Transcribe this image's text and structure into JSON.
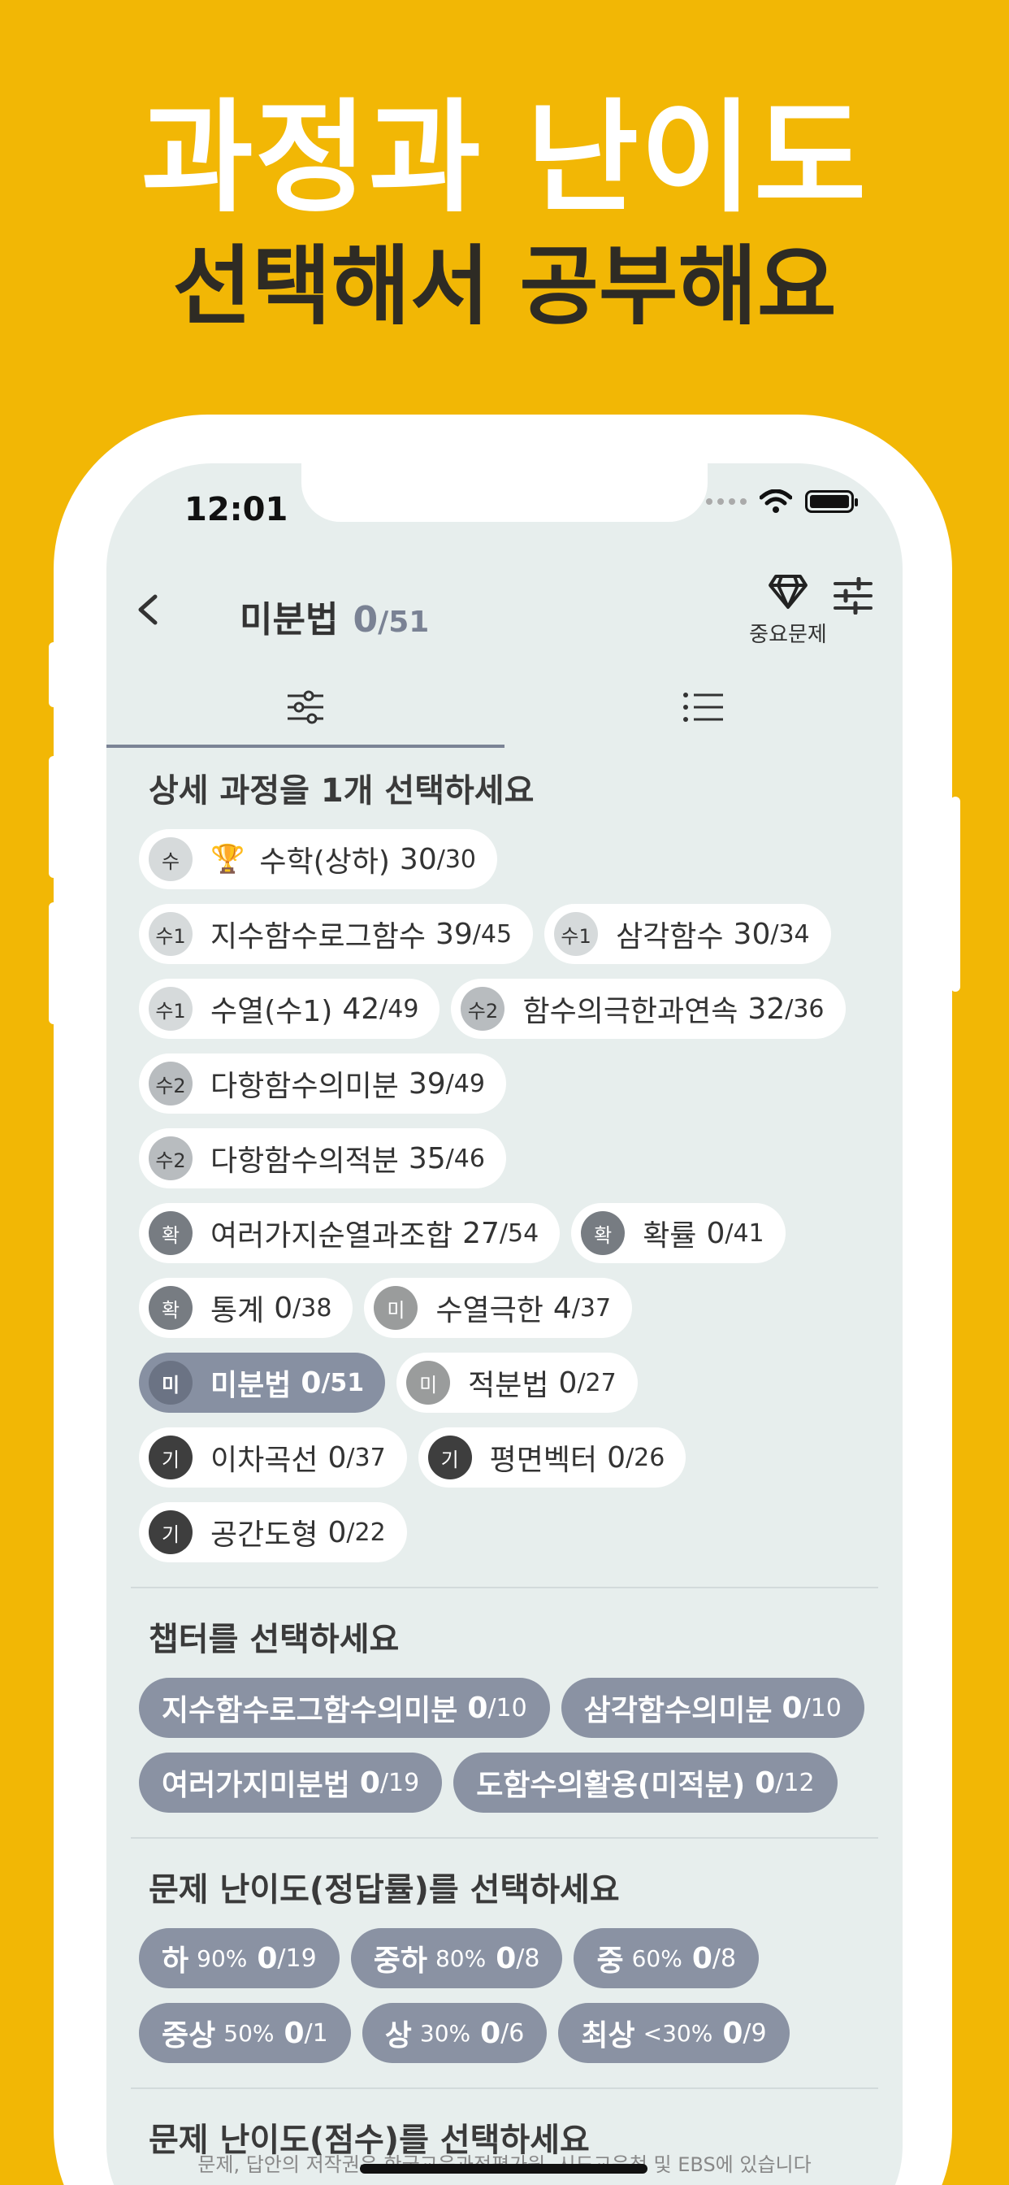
{
  "hero": {
    "title": "과정과 난이도",
    "subtitle": "선택해서 공부해요"
  },
  "status": {
    "time": "12:01"
  },
  "nav": {
    "title": "미분법",
    "count": "0",
    "total": "/51",
    "important_label": "중요문제"
  },
  "section1": {
    "title": "상세 과정을 1개 선택하세요",
    "chips": [
      {
        "badge": "수",
        "trophy": "🏆",
        "label": "수학(상하)",
        "num": "30",
        "den": "/30",
        "tone": "light"
      },
      {
        "badge": "수1",
        "label": "지수함수로그함수",
        "num": "39",
        "den": "/45",
        "tone": "light"
      },
      {
        "badge": "수1",
        "label": "삼각함수",
        "num": "30",
        "den": "/34",
        "tone": "light"
      },
      {
        "badge": "수1",
        "label": "수열(수1)",
        "num": "42",
        "den": "/49",
        "tone": "light"
      },
      {
        "badge": "수2",
        "label": "함수의극한과연속",
        "num": "32",
        "den": "/36",
        "tone": "mid"
      },
      {
        "badge": "수2",
        "label": "다항함수의미분",
        "num": "39",
        "den": "/49",
        "tone": "mid"
      },
      {
        "badge": "수2",
        "label": "다항함수의적분",
        "num": "35",
        "den": "/46",
        "tone": "mid"
      },
      {
        "badge": "확",
        "label": "여러가지순열과조합",
        "num": "27",
        "den": "/54",
        "tone": "dark"
      },
      {
        "badge": "확",
        "label": "확률",
        "num": "0",
        "den": "/41",
        "tone": "dark"
      },
      {
        "badge": "확",
        "label": "통계",
        "num": "0",
        "den": "/38",
        "tone": "dark"
      },
      {
        "badge": "미",
        "label": "수열극한",
        "num": "4",
        "den": "/37",
        "tone": "mi"
      },
      {
        "badge": "미",
        "label": "미분법",
        "num": "0",
        "den": "/51",
        "tone": "sel",
        "selected": true
      },
      {
        "badge": "미",
        "label": "적분법",
        "num": "0",
        "den": "/27",
        "tone": "mi"
      },
      {
        "badge": "기",
        "label": "이차곡선",
        "num": "0",
        "den": "/37",
        "tone": "gi"
      },
      {
        "badge": "기",
        "label": "평면벡터",
        "num": "0",
        "den": "/26",
        "tone": "gi"
      },
      {
        "badge": "기",
        "label": "공간도형",
        "num": "0",
        "den": "/22",
        "tone": "gi"
      }
    ]
  },
  "section2": {
    "title": "챕터를 선택하세요",
    "chips": [
      {
        "label": "지수함수로그함수의미분",
        "num": "0",
        "den": "/10"
      },
      {
        "label": "삼각함수의미분",
        "num": "0",
        "den": "/10"
      },
      {
        "label": "여러가지미분법",
        "num": "0",
        "den": "/19"
      },
      {
        "label": "도함수의활용(미적분)",
        "num": "0",
        "den": "/12"
      }
    ]
  },
  "section3": {
    "title": "문제 난이도(정답률)를 선택하세요",
    "chips": [
      {
        "label": "하",
        "pct": "90%",
        "num": "0",
        "den": "/19"
      },
      {
        "label": "중하",
        "pct": "80%",
        "num": "0",
        "den": "/8"
      },
      {
        "label": "중",
        "pct": "60%",
        "num": "0",
        "den": "/8"
      },
      {
        "label": "중상",
        "pct": "50%",
        "num": "0",
        "den": "/1"
      },
      {
        "label": "상",
        "pct": "30%",
        "num": "0",
        "den": "/6"
      },
      {
        "label": "최상",
        "pct": "<30%",
        "num": "0",
        "den": "/9"
      }
    ]
  },
  "section4": {
    "title": "문제 난이도(점수)를 선택하세요"
  },
  "footer": {
    "copyright": "문제, 답안의 저작권은 한국교육과정평가원, 시도교육청 및 EBS에 있습니다"
  }
}
